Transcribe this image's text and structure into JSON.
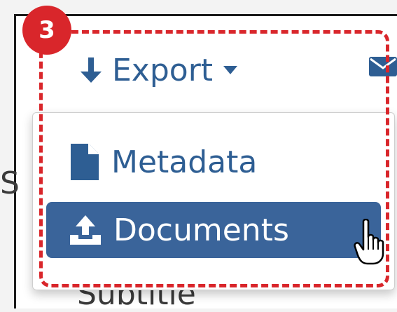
{
  "annotation": {
    "step_number": "3"
  },
  "toolbar": {
    "export_label": "Export",
    "export_icon": "arrow-down-icon",
    "mail_icon": "envelope-icon"
  },
  "export_menu": {
    "items": [
      {
        "label": "Metadata",
        "icon": "file-icon",
        "active": false
      },
      {
        "label": "Documents",
        "icon": "upload-icon",
        "active": true
      }
    ]
  },
  "background_fragments": {
    "left_letter": "S",
    "bottom_text": "Subtitle"
  },
  "colors": {
    "link_blue": "#2e5e93",
    "active_item_bg": "#3a649a",
    "annotation_red": "#d9262b"
  }
}
